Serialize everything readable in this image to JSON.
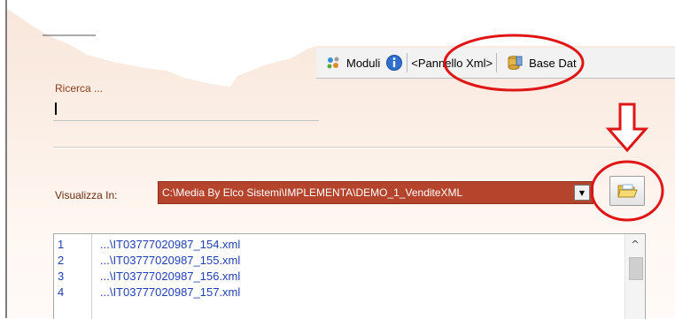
{
  "toolbar": {
    "moduli_label": "Moduli",
    "pannello_label": "<Pannello Xml>",
    "basedati_label": "Base Dat"
  },
  "search": {
    "label": "Ricerca ..."
  },
  "visualizza": {
    "label": "Visualizza In:",
    "path": "C:\\Media By Elco Sistemi\\IMPLEMENTA\\DEMO_1_VenditeXML"
  },
  "files": [
    {
      "num": "1",
      "name": "...\\IT03777020987_154.xml"
    },
    {
      "num": "2",
      "name": "...\\IT03777020987_155.xml"
    },
    {
      "num": "3",
      "name": "...\\IT03777020987_156.xml"
    },
    {
      "num": "4",
      "name": "...\\IT03777020987_157.xml"
    }
  ],
  "colors": {
    "annotation": "#e01515",
    "path_bg": "#b4442c",
    "file_text": "#1f3fb0"
  },
  "icons": [
    "moduli-icon",
    "info-icon",
    "database-icon",
    "folder-open-icon",
    "chevron-down-icon",
    "scroll-up-icon"
  ]
}
